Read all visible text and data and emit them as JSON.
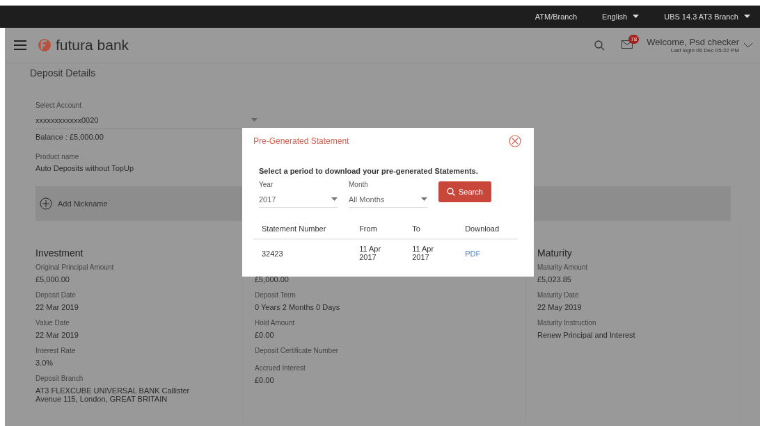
{
  "top_bar": {
    "links": [
      {
        "label": "ATM/Branch",
        "dropdown": false
      },
      {
        "label": "English",
        "dropdown": true
      },
      {
        "label": "UBS 14.3 AT3 Branch",
        "dropdown": true
      }
    ]
  },
  "header": {
    "logo": "futura bank",
    "notification_count": "78",
    "welcome": "Welcome, Psd checker",
    "last_login": "Last login 06 Dec 05:22 PM"
  },
  "page_title": "Deposit Details",
  "account": {
    "label": "Select Account",
    "value": "xxxxxxxxxxxx0020",
    "balance": "Balance : £5,000.00"
  },
  "product": {
    "label": "Product name",
    "value": "Auto Deposits without TopUp"
  },
  "nickname_button": "Add Nickname",
  "columns": [
    {
      "heading": "Investment",
      "fields": [
        {
          "label": "Original Principal Amount",
          "value": "£5,000.00"
        },
        {
          "label": "Deposit Date",
          "value": "22 Mar 2019"
        },
        {
          "label": "Value Date",
          "value": "22 Mar 2019"
        },
        {
          "label": "Interest Rate",
          "value": "3.0%"
        },
        {
          "label": "Deposit Branch",
          "value": "AT3 FLEXCUBE UNIVERSAL BANK Callister Avenue 115, London, GREAT BRITAIN"
        }
      ]
    },
    {
      "fields": [
        {
          "value": "£5,000.00"
        },
        {
          "label": "Deposit Term",
          "value": "0 Years 2 Months 0 Days"
        },
        {
          "label": "Hold Amount",
          "value": "£0.00"
        },
        {
          "label": "Deposit Certificate Number"
        },
        {
          "label": "Accrued Interest",
          "value": "£0.00"
        }
      ]
    },
    {
      "heading": "Maturity",
      "fields": [
        {
          "label": "Maturity Amount",
          "value": "£5,023.85"
        },
        {
          "label": "Maturity Date",
          "value": "22 May 2019"
        },
        {
          "label": "Maturity Instruction",
          "value": "Renew Principal and Interest"
        }
      ]
    }
  ],
  "modal": {
    "title": "Pre-Generated Statement",
    "instruction": "Select a period to download your pre-generated Statements.",
    "year": {
      "label": "Year",
      "value": "2017"
    },
    "month": {
      "label": "Month",
      "value": "All Months"
    },
    "search_button": "Search",
    "table": {
      "columns": [
        "Statement Number",
        "From",
        "To",
        "Download"
      ],
      "rows": [
        {
          "number": "32423",
          "from": "11 Apr 2017",
          "to": "11 Apr 2017",
          "download": "PDF"
        }
      ]
    }
  }
}
